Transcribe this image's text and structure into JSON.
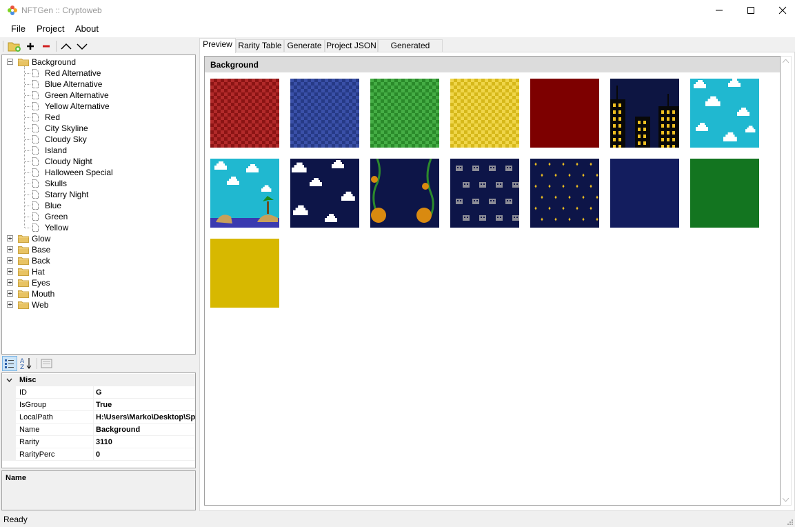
{
  "window": {
    "title": "NFTGen :: Cryptoweb"
  },
  "menu": {
    "file": "File",
    "project": "Project",
    "about": "About"
  },
  "tree": {
    "root": "Background",
    "children": [
      "Red Alternative",
      "Blue Alternative",
      "Green Alternative",
      "Yellow Alternative",
      "Red",
      "City Skyline",
      "Cloudy Sky",
      "Island",
      "Cloudy Night",
      "Halloween Special",
      "Skulls",
      "Starry Night",
      "Blue",
      "Green",
      "Yellow"
    ],
    "groups": [
      "Glow",
      "Base",
      "Back",
      "Hat",
      "Eyes",
      "Mouth",
      "Web"
    ]
  },
  "props": {
    "category": "Misc",
    "rows": [
      {
        "name": "ID",
        "value": "G"
      },
      {
        "name": "IsGroup",
        "value": "True"
      },
      {
        "name": "LocalPath",
        "value": "H:\\Users\\Marko\\Desktop\\Sp"
      },
      {
        "name": "Name",
        "value": "Background"
      },
      {
        "name": "Rarity",
        "value": "3110"
      },
      {
        "name": "RarityPerc",
        "value": "0"
      }
    ],
    "desc_title": "Name"
  },
  "tabs": [
    "Preview",
    "Rarity Table",
    "Generate",
    "Project JSON",
    "Generated JSON"
  ],
  "preview": {
    "group_title": "Background",
    "items": [
      {
        "name": "Red Alternative",
        "kind": "checker",
        "c1": "#8b1414",
        "c2": "#b22a2a"
      },
      {
        "name": "Blue Alternative",
        "kind": "checker",
        "c1": "#263a86",
        "c2": "#3a50a8"
      },
      {
        "name": "Green Alternative",
        "kind": "checker",
        "c1": "#2a8a2a",
        "c2": "#45ad45"
      },
      {
        "name": "Yellow Alternative",
        "kind": "checker",
        "c1": "#d6b81a",
        "c2": "#f0d64a"
      },
      {
        "name": "Red",
        "kind": "solid",
        "c1": "#7d0000"
      },
      {
        "name": "City Skyline",
        "kind": "city",
        "c1": "#0d1542"
      },
      {
        "name": "Cloudy Sky",
        "kind": "sky",
        "c1": "#20b8d0"
      },
      {
        "name": "Island",
        "kind": "island",
        "c1": "#20b8d0"
      },
      {
        "name": "Cloudy Night",
        "kind": "night-clouds",
        "c1": "#0d1548"
      },
      {
        "name": "Halloween Special",
        "kind": "halloween",
        "c1": "#0d1548"
      },
      {
        "name": "Skulls",
        "kind": "skulls",
        "c1": "#0d1548"
      },
      {
        "name": "Starry Night",
        "kind": "stars",
        "c1": "#0d1548"
      },
      {
        "name": "Blue",
        "kind": "solid",
        "c1": "#131d5e"
      },
      {
        "name": "Green",
        "kind": "solid",
        "c1": "#137520"
      },
      {
        "name": "Yellow",
        "kind": "solid",
        "c1": "#d7b800"
      }
    ]
  },
  "status": "Ready"
}
